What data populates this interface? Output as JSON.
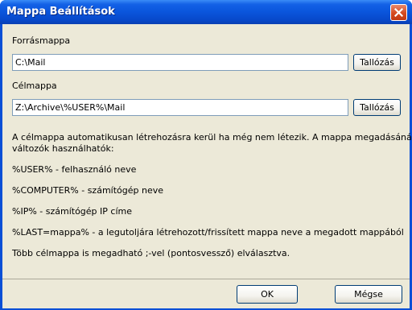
{
  "window": {
    "title": "Mappa Beállítások"
  },
  "source": {
    "label": "Forrásmappa",
    "value": "C:\\Mail",
    "browse_label": "Tallózás"
  },
  "target": {
    "label": "Célmappa",
    "value": "Z:\\Archive\\%USER%\\Mail",
    "browse_label": "Tallózás"
  },
  "help": {
    "intro_line1": "A célmappa automatikusan létrehozásra kerül ha még nem létezik. A mappa megadásánál az alábbi",
    "intro_line2": "változók használhatók:",
    "var_user": "%USER% - felhasználó neve",
    "var_computer": "%COMPUTER% - számítógép neve",
    "var_ip": "%IP% - számítógép IP címe",
    "var_last": "%LAST=mappa% - a legutoljára létrehozott/frissített mappa neve a megadott mappából",
    "multi": "Több célmappa is megadható ;-vel (pontosvessző) elválasztva."
  },
  "buttons": {
    "ok": "OK",
    "cancel": "Mégse"
  },
  "colors": {
    "titlebar": "#0a55dc",
    "dialog_bg": "#ece9d8",
    "close_button": "#d5491f"
  }
}
